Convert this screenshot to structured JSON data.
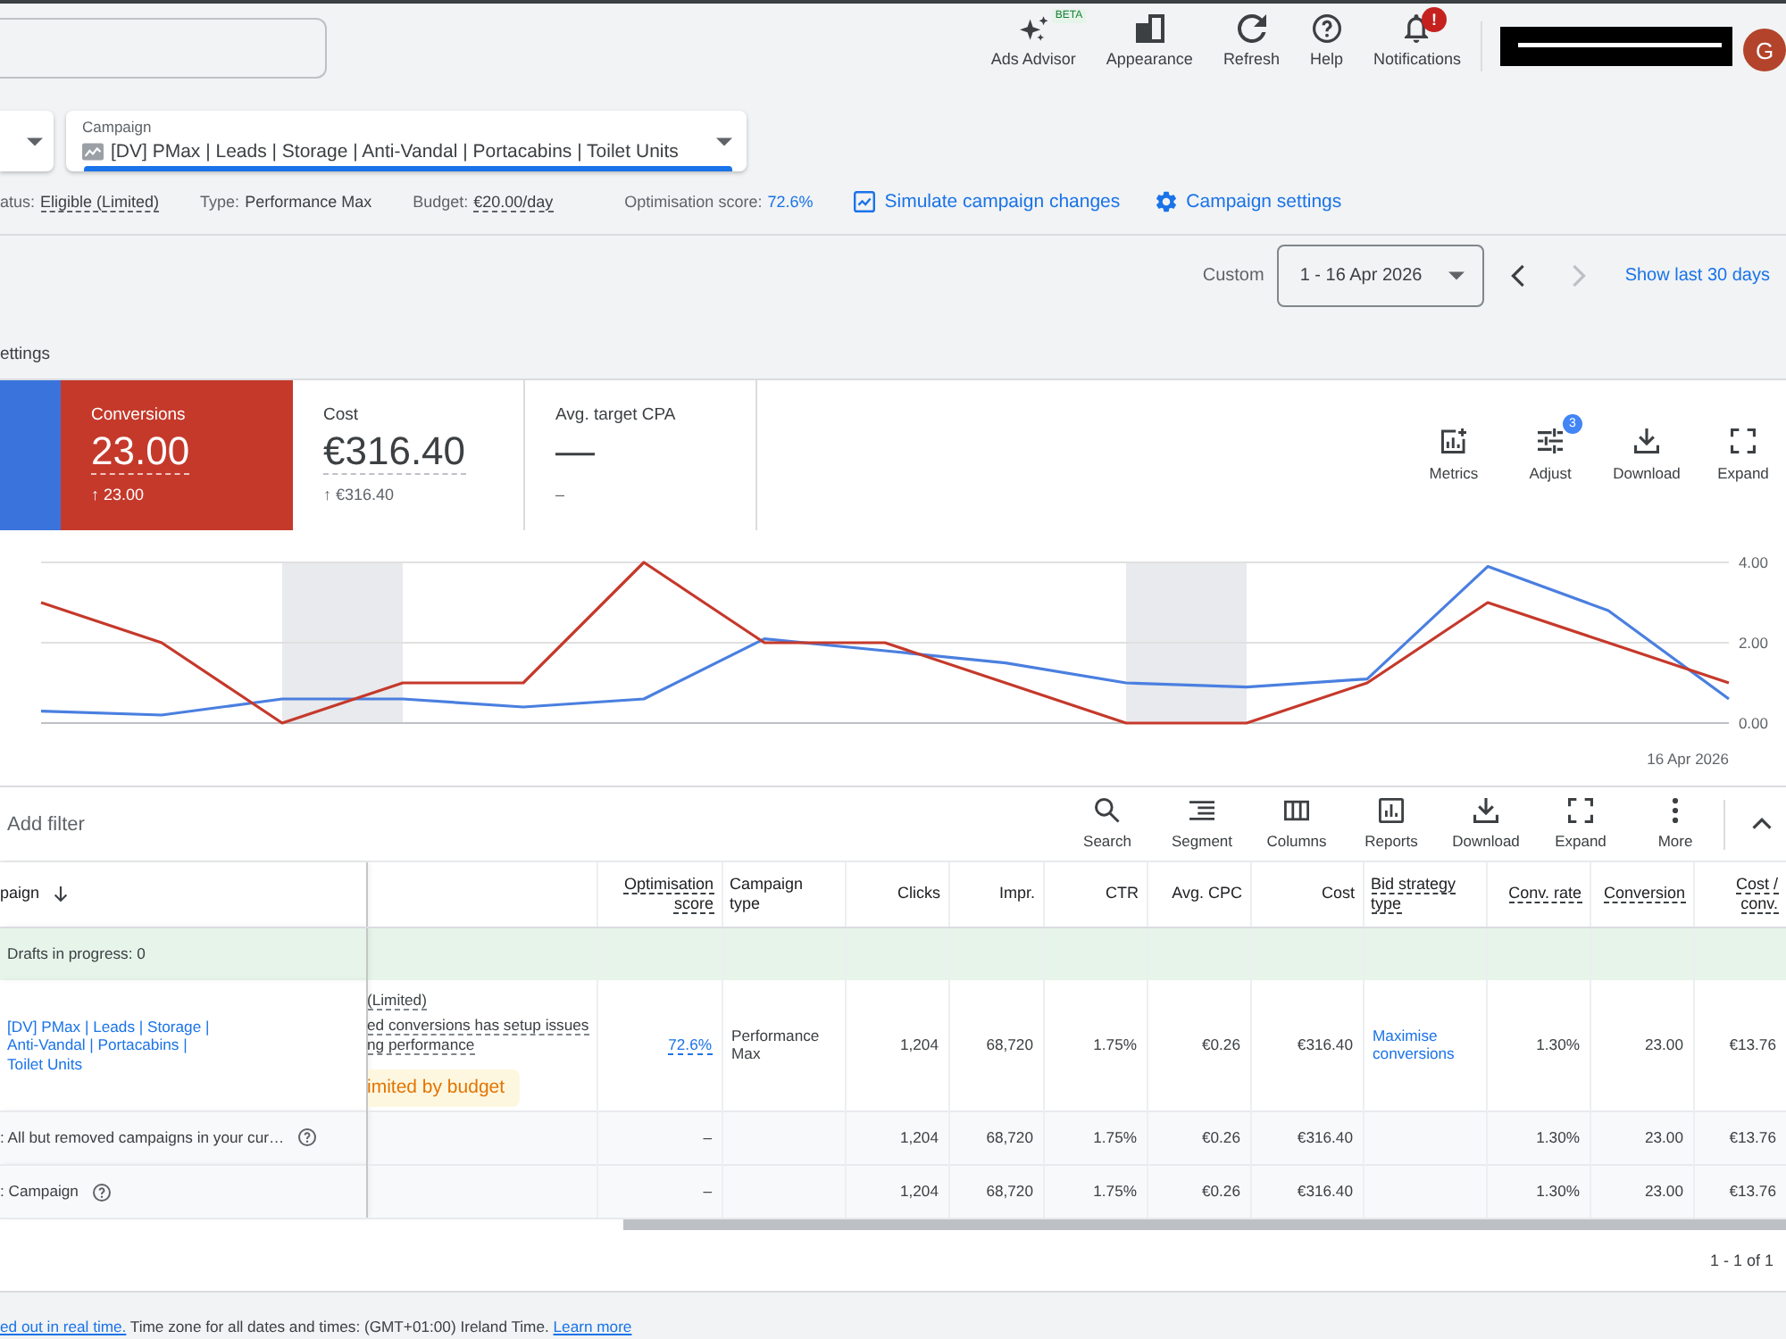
{
  "header": {
    "tools": [
      {
        "kind": "sparkle",
        "label": "Ads Advisor",
        "badge": "BETA"
      },
      {
        "kind": "appearance",
        "label": "Appearance"
      },
      {
        "kind": "refresh",
        "label": "Refresh"
      },
      {
        "kind": "help",
        "label": "Help"
      },
      {
        "kind": "bell",
        "label": "Notifications",
        "alert": "!"
      }
    ],
    "avatar": "G"
  },
  "selectors": {
    "campaign": {
      "label": "Campaign",
      "value": "[DV] PMax | Leads | Storage | Anti-Vandal | Portacabins | Toilet Units"
    }
  },
  "summary": [
    {
      "kind": "dotted",
      "label": "atus:",
      "value": "Eligible (Limited)"
    },
    {
      "kind": "plain",
      "label": "Type:",
      "value": "Performance Max"
    },
    {
      "kind": "dotted",
      "label": "Budget:",
      "value": "€20.00/day"
    },
    {
      "kind": "link",
      "label": "Optimisation score:",
      "value": "72.6%"
    }
  ],
  "actions": [
    {
      "kind": "simulate",
      "label": "Simulate campaign changes"
    },
    {
      "kind": "settings",
      "label": "Campaign settings"
    }
  ],
  "date_range": {
    "label": "Custom",
    "value": "1 - 16 Apr 2026",
    "previous": {
      "disabled": false
    },
    "next": {
      "disabled": true
    },
    "shortcut": "Show last 30 days"
  },
  "section_title": "ettings",
  "scorecards": [
    {
      "selected": true,
      "color": "#3b73dc"
    },
    {
      "label": "Conversions",
      "value": "23.00",
      "change": "↑ 23.00",
      "dotted": true,
      "selected": true,
      "color": "#c5392b"
    },
    {
      "label": "Cost",
      "value": "€316.40",
      "change": "↑ €316.40",
      "dotted": true,
      "selected": false
    },
    {
      "label": "Avg. target CPA",
      "value": "—",
      "change": "–",
      "dotted": false,
      "selected": false
    }
  ],
  "chart_tools": [
    {
      "kind": "metrics",
      "label": "Metrics"
    },
    {
      "kind": "adjust",
      "label": "Adjust",
      "badge": "3"
    },
    {
      "kind": "download",
      "label": "Download"
    },
    {
      "kind": "expand",
      "label": "Expand"
    }
  ],
  "chart": {
    "date_label": "16 Apr 2026",
    "chart_data": {
      "type": "line",
      "ylim": [
        0,
        4
      ],
      "yticks": [
        {
          "value": 0,
          "label": "0.00"
        },
        {
          "value": 2,
          "label": "2.00"
        },
        {
          "value": 4,
          "label": "4.00"
        }
      ],
      "series": [
        {
          "color": "#4a7fe0",
          "values": [
            0.3,
            0.2,
            0.6,
            0.6,
            0.4,
            0.6,
            2.1,
            1.8,
            1.5,
            1.0,
            0.9,
            1.1,
            3.9,
            2.8,
            0.6
          ]
        },
        {
          "color": "#c5392b",
          "values": [
            3,
            2,
            0,
            1,
            1,
            4,
            2,
            2,
            1,
            0,
            0,
            1,
            3,
            2,
            1
          ]
        }
      ]
    }
  },
  "table": {
    "filter": {
      "placeholder": "Add filter"
    },
    "tools": [
      {
        "kind": "search",
        "label": "Search"
      },
      {
        "kind": "segment",
        "label": "Segment"
      },
      {
        "kind": "columns",
        "label": "Columns"
      },
      {
        "kind": "reports",
        "label": "Reports"
      },
      {
        "kind": "download",
        "label": "Download"
      },
      {
        "kind": "expand",
        "label": "Expand"
      },
      {
        "kind": "more",
        "label": "More"
      }
    ],
    "columns": [
      {
        "label": "paign",
        "sorted": true,
        "dotted": false
      },
      {
        "sorted": false
      },
      {
        "label": "Optimisation score",
        "sorted": false,
        "dotted": true
      },
      {
        "label": "Campaign type",
        "sorted": false,
        "dotted": false
      },
      {
        "label": "Clicks",
        "sorted": false,
        "dotted": false
      },
      {
        "label": "Impr.",
        "sorted": false,
        "dotted": false
      },
      {
        "label": "CTR",
        "sorted": false,
        "dotted": false
      },
      {
        "label": "Avg. CPC",
        "sorted": false,
        "dotted": false
      },
      {
        "label": "Cost",
        "sorted": false,
        "dotted": false
      },
      {
        "label": "Bid strategy type",
        "sorted": false,
        "dotted": true
      },
      {
        "label": "Conv. rate",
        "sorted": false,
        "dotted": true
      },
      {
        "label": "Conversion",
        "sorted": false,
        "dotted": true
      },
      {
        "label": "Cost / conv.",
        "sorted": false,
        "dotted": true
      }
    ],
    "drafts": "Drafts in progress: 0",
    "rows": [
      {
        "kind": "campaign",
        "cells": [
          {
            "kind": "link",
            "text": "[DV] PMax | Leads | Storage | Anti-Vandal | Portacabins | Toilet Units"
          },
          {
            "kind": "status",
            "lines": [
              "(Limited)",
              "ed conversions has setup issues",
              "ng performance"
            ],
            "chip": "imited by budget"
          },
          {
            "kind": "score",
            "text": "72.6%"
          },
          {
            "kind": "text",
            "text": "Performance Max"
          },
          {
            "kind": "number",
            "text": "1,204"
          },
          {
            "kind": "number",
            "text": "68,720"
          },
          {
            "kind": "number",
            "text": "1.75%"
          },
          {
            "kind": "number",
            "text": "€0.26"
          },
          {
            "kind": "number",
            "text": "€316.40"
          },
          {
            "kind": "link",
            "text": "Maximise conversions"
          },
          {
            "kind": "number",
            "text": "1.30%"
          },
          {
            "kind": "number",
            "text": "23.00"
          },
          {
            "kind": "number",
            "text": "€13.76"
          }
        ]
      },
      {
        "kind": "total",
        "cells": [
          {
            "kind": "help",
            "text": ": All but removed campaigns in your cur…"
          },
          null,
          {
            "kind": "number",
            "text": "–"
          },
          null,
          {
            "kind": "number",
            "text": "1,204"
          },
          {
            "kind": "number",
            "text": "68,720"
          },
          {
            "kind": "number",
            "text": "1.75%"
          },
          {
            "kind": "number",
            "text": "€0.26"
          },
          {
            "kind": "number",
            "text": "€316.40"
          },
          null,
          {
            "kind": "number",
            "text": "1.30%"
          },
          {
            "kind": "number",
            "text": "23.00"
          },
          {
            "kind": "number",
            "text": "€13.76"
          }
        ]
      },
      {
        "kind": "total",
        "cells": [
          {
            "kind": "help",
            "text": ": Campaign"
          },
          null,
          {
            "kind": "number",
            "text": "–"
          },
          null,
          {
            "kind": "number",
            "text": "1,204"
          },
          {
            "kind": "number",
            "text": "68,720"
          },
          {
            "kind": "number",
            "text": "1.75%"
          },
          {
            "kind": "number",
            "text": "€0.26"
          },
          {
            "kind": "number",
            "text": "€316.40"
          },
          null,
          {
            "kind": "number",
            "text": "1.30%"
          },
          {
            "kind": "number",
            "text": "23.00"
          },
          {
            "kind": "number",
            "text": "€13.76"
          }
        ]
      }
    ],
    "pagination": "1 - 1 of 1"
  },
  "footer": {
    "cut_link": "ed out in real time.",
    "text": "Time zone for all dates and times: (GMT+01:00) Ireland Time.",
    "link": "Learn more"
  }
}
